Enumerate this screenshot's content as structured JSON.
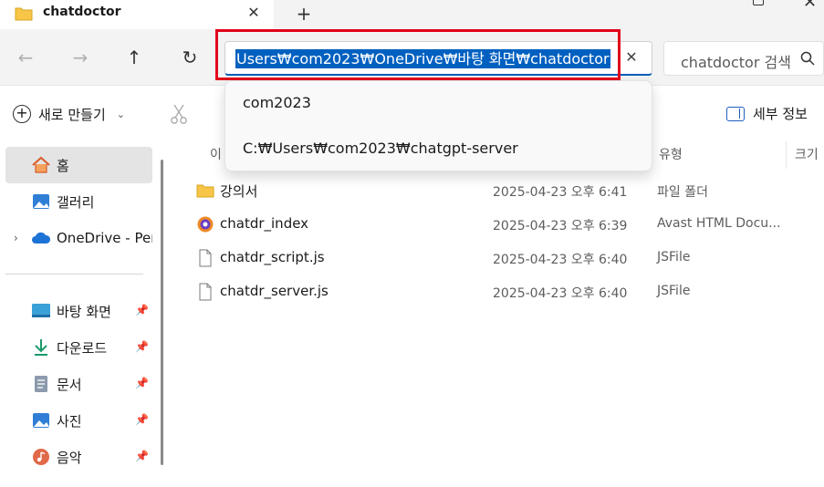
{
  "tab": {
    "title": "chatdoctor",
    "close": "✕",
    "new_tab": "+"
  },
  "nav": {
    "back": "←",
    "forward": "→",
    "up": "↑",
    "refresh": "↻",
    "address_value": "Users₩com2023₩OneDrive₩바탕 화면₩chatdoctor",
    "address_clear": "✕",
    "search_placeholder": "chatdoctor 검색",
    "icons": {
      "search": "search-icon"
    }
  },
  "address_suggestions": [
    {
      "label": "com2023"
    },
    {
      "label": "C:₩Users₩com2023₩chatgpt-server"
    }
  ],
  "commands": {
    "new_label": "새로 만들기",
    "new_caret": "⌄",
    "details_label": "세부 정보",
    "icons": {
      "new": "plus-circle-icon",
      "cut": "scissors-icon",
      "details": "details-pane-icon"
    }
  },
  "sidebar": {
    "items": [
      {
        "label": "홈",
        "icon": "home-icon"
      },
      {
        "label": "갤러리",
        "icon": "gallery-icon"
      },
      {
        "label": "OneDrive - Pers",
        "icon": "onedrive-cloud-icon",
        "expander": "›"
      },
      {
        "label": "바탕 화면",
        "icon": "desktop-icon",
        "pin": "📌"
      },
      {
        "label": "다운로드",
        "icon": "download-icon",
        "pin": "📌"
      },
      {
        "label": "문서",
        "icon": "document-icon",
        "pin": "📌"
      },
      {
        "label": "사진",
        "icon": "pictures-icon",
        "pin": "📌"
      },
      {
        "label": "음악",
        "icon": "music-icon",
        "pin": "📌"
      }
    ]
  },
  "columns": {
    "name": "이",
    "type": "유형",
    "size": "크기"
  },
  "files": [
    {
      "name": "강의서",
      "date": "2025-04-23 오후 6:41",
      "type": "파일 폴더",
      "icon": "folder-icon"
    },
    {
      "name": "chatdr_index",
      "date": "2025-04-23 오후 6:39",
      "type": "Avast HTML Docu...",
      "icon": "avast-html-icon"
    },
    {
      "name": "chatdr_script.js",
      "date": "2025-04-23 오후 6:40",
      "type": "JSFile",
      "icon": "file-icon"
    },
    {
      "name": "chatdr_server.js",
      "date": "2025-04-23 오후 6:40",
      "type": "JSFile",
      "icon": "file-icon"
    }
  ],
  "colors": {
    "accent": "#005fb8",
    "selection": "#0060c0",
    "highlight_box": "#e1001a",
    "folder": "#f7c548"
  }
}
